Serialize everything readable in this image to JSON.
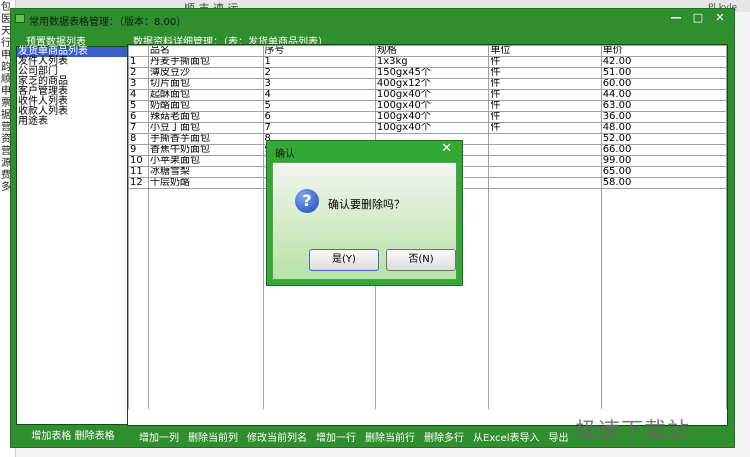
{
  "background": {
    "brand_text": "顺 丰 速 运",
    "corner_tag": "Pl.kyle",
    "left_chars": [
      "包",
      "医",
      "天",
      "行",
      "申",
      "韵",
      "顺",
      "申",
      "票",
      "据",
      "营",
      "资",
      "营",
      "源",
      "费",
      "多"
    ]
  },
  "window": {
    "title": "常用数据表格管理：（版本：8.00）",
    "controls": [
      "—",
      "□",
      "✕"
    ]
  },
  "left_panel": {
    "header": "预置数据列表",
    "items": [
      "发货单商品列表",
      "发件人列表",
      "公司部门",
      "家乏的商品",
      "客户管理表",
      "收件人列表",
      "收款人列表",
      "用途表"
    ],
    "footer": "增加表格 删除表格"
  },
  "right_panel": {
    "header": "数据资料详细管理：（表：发货单商品列表）",
    "columns": [
      "品名",
      "序号",
      "规格",
      "单位",
      "单价"
    ],
    "rows": [
      {
        "idx": "1",
        "name": "丹麦手撕面包",
        "seq": "1",
        "spec": "1x3kg",
        "unit": "件",
        "price": "42.00"
      },
      {
        "idx": "2",
        "name": "薄皮豆沙",
        "seq": "2",
        "spec": "150gx45个",
        "unit": "件",
        "price": "51.00"
      },
      {
        "idx": "3",
        "name": "切片面包",
        "seq": "3",
        "spec": "400gx12个",
        "unit": "件",
        "price": "60.00"
      },
      {
        "idx": "4",
        "name": "起酥面包",
        "seq": "4",
        "spec": "100gx40个",
        "unit": "件",
        "price": "44.00"
      },
      {
        "idx": "5",
        "name": "奶酪面包",
        "seq": "5",
        "spec": "100gx40个",
        "unit": "件",
        "price": "63.00"
      },
      {
        "idx": "6",
        "name": "辣菇老面包",
        "seq": "6",
        "spec": "100gx40个",
        "unit": "件",
        "price": "36.00"
      },
      {
        "idx": "7",
        "name": "小豆丁面包",
        "seq": "7",
        "spec": "100gx40个",
        "unit": "件",
        "price": "48.00"
      },
      {
        "idx": "8",
        "name": "手撕香芋面包",
        "seq": "8",
        "spec": "",
        "unit": "",
        "price": "52.00"
      },
      {
        "idx": "9",
        "name": "香蕉牛奶面包",
        "seq": "9",
        "spec": "",
        "unit": "",
        "price": "66.00"
      },
      {
        "idx": "10",
        "name": "小苹果面包",
        "seq": "1",
        "spec": "",
        "unit": "",
        "price": "99.00"
      },
      {
        "idx": "11",
        "name": "冰糖雪梨",
        "seq": "1",
        "spec": "",
        "unit": "",
        "price": "65.00"
      },
      {
        "idx": "12",
        "name": "千层奶酪",
        "seq": "1",
        "spec": "",
        "unit": "",
        "price": "58.00"
      }
    ],
    "toolbar": [
      "增加一列",
      "删除当前列",
      "修改当前列名",
      "增加一行",
      "删除当前行",
      "删除多行",
      "从Excel表导入",
      "导出"
    ]
  },
  "watermark": "极速下载站",
  "dialog": {
    "title": "确认",
    "close": "✕",
    "icon": "question-icon",
    "message": "确认要删除吗？",
    "yes_label": "是(Y)",
    "no_label": "否(N)"
  },
  "colors": {
    "window_green": "#2f8f2f",
    "selection_blue": "#3b5fc8"
  }
}
